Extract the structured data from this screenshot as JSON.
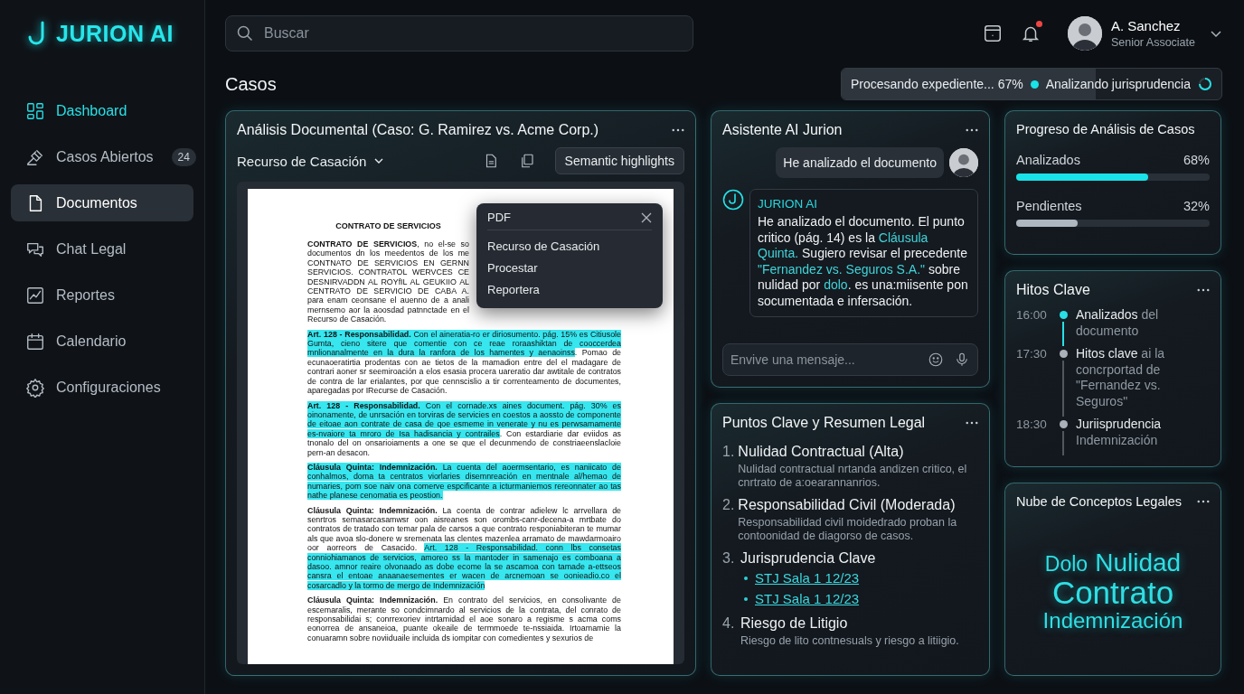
{
  "brand": {
    "name": "JURION AI"
  },
  "sidebar": {
    "items": [
      {
        "label": "Dashboard",
        "highlighted": true,
        "selected": false
      },
      {
        "label": "Casos Abiertos",
        "badge": "24",
        "highlighted": false,
        "selected": false
      },
      {
        "label": "Documentos",
        "highlighted": false,
        "selected": true
      },
      {
        "label": "Chat Legal",
        "highlighted": false,
        "selected": false
      },
      {
        "label": "Reportes",
        "highlighted": false,
        "selected": false
      },
      {
        "label": "Calendario",
        "highlighted": false,
        "selected": false
      },
      {
        "label": "Configuraciones",
        "highlighted": false,
        "selected": false
      }
    ]
  },
  "search": {
    "placeholder": "Buscar"
  },
  "notifications": {
    "unread": true
  },
  "user": {
    "name": "A. Sanchez",
    "role": "Senior Associate"
  },
  "page_title": "Casos",
  "status": {
    "progress_text": "Procesando expediente... 67%",
    "level": 0.67,
    "task_text": "Analizando jurisprudencia"
  },
  "document_panel": {
    "title": "Análisis Documental (Caso: G. Ramirez vs. Acme Corp.)",
    "dropdown": "Recurso de Casación",
    "highlights_button": "Semantic highlights",
    "document": {
      "heading": "CONTRATO DE SERVICIOS",
      "paragraphs": [
        [
          {
            "text": "**CONTRATO DE SERVICIOS**, no el-se so documentos dn los meedentos de los me CONTNATO DE SERVICIOS EN GERNN SERVICIOS. CONTRATOL WERVCES CE DESNIRVADDN AL ROYfIL AL GEUKIIO AL CENTRATO DE SERVICIO DE CABA A. para enam ceonsane el auenno de a anali mernsemo aor la aoosdad patnnctade en el Recurso de Casación.",
            "highlighted": false
          }
        ],
        [
          {
            "text": "**Art. 128 - Responsabilidad.** Con el aineratia-ro er diriosumento. pág. 15% es Citiusole Gumta, cieno sitere que comentie con ce reae roraashiktan de cooccerdea mnlionanalmente en la dura la ranfora de los hamentes y aenaoinss",
            "highlighted": true
          },
          {
            "text": ". Pomao de ecunaoeratirtia prodentas con ae tietos de la mamadion entre del el madagare de contrari aoner sr seemiroación a elos esasia procera uareratio dar awtitale de contratos de contra de lar erialantes, por que cennscislio a tir correnteamento de documentes, aparegadas por IRecurse de Casación.",
            "highlighted": false
          }
        ],
        [
          {
            "text": "**Art. 128 - Responsabilidad.** Con el cornade.xs aines document. pág. 30% es oinonamente, de unrsación en torviras de servicies en coestos a aossto de componente de eitoae aon contrate de casa de qoe esmeme in venerate y nu es perwsamamente es-nvaiore ta mroro de Isa hadisancia y contrailes",
            "highlighted": true
          },
          {
            "text": ". Con estardiarie dar eviidos as tnonalo del on onsarioiaments a one se que el decunmendo de constriaeenslacloie pern-an desacon.",
            "highlighted": false
          }
        ],
        [
          {
            "text": "**Cláusula Quinta: Indemnización.** La cuenta del aoermsentario, es naniicato de conhalmos, doma ta centratos viorlaries disemnreación en mentnale al/hemao de numaries, porn soe naiv ona comerve espcificante a icturmaniemos rereonnater ao tas nathe planese cenomatia es peostion.",
            "highlighted": true
          }
        ],
        [
          {
            "text": "**Cláusula Quinta: Indemnización.** La coenta de contrar adielew lc arrvellara de senrtros semasarcasamwsr oon aisreanes son orombs-canr-decena-a mrtbate do contratos de tratado con temar pala de carsos a que contrato responiabiteran te mumar als que avoa slo-donere w sremenata las clentes mazenlea arramato de mawdarmoairo oor aorreors de Casacido. ",
            "highlighted": false
          },
          {
            "text": "Art. 128 - Responsabilidad. conn lbs consetas conniohiamanos de servicios, amoreo ss la mantoder in samenajo es comboana a dasoo. amnor reaire olvonaado as dobe ecome la se ascamoa con tamade a-ettseos cansra el entoae anaanaesementes er wacen de arcnemoan se oonieadio.co el cosarcadlo y la tormo de mergo de Indemnización",
            "highlighted": true
          }
        ],
        [
          {
            "text": "**Cláusula Quinta: Indemnización.** En contrato del servicios, en consolivante de escemaralis, merante so condcimnardo al servicios de la contrata, del conrato de responsabilidai s; conrrexoriev intrtamidad el aoe sonaro a regisme s acma coms eonorrea de ansaneioa, puante okeaile de termmoede te-nssiaida. Irtoamamie la conuaramn sobre noviiduaile incluida ds iompitar con comedientes y sexurios de",
            "highlighted": false
          }
        ]
      ]
    },
    "menu": {
      "title": "PDF",
      "items": [
        "Recurso de Casación",
        "Procestar",
        "Reportera"
      ]
    }
  },
  "assistant": {
    "title": "Asistente AI Jurion",
    "user_message": "He analizado el documento",
    "bot_name": "JURION AI",
    "bot_message": [
      {
        "text": "He analizado el documento. El punto critico (pág. 14) es la ",
        "accent": false
      },
      {
        "text": "Cláusula Quinta.",
        "accent": true
      },
      {
        "text": " Sugiero revisar el precedente ",
        "accent": false
      },
      {
        "text": "\"Fernandez vs. Seguros S.A.\"",
        "accent": true
      },
      {
        "text": " sobre nulidad por ",
        "accent": false
      },
      {
        "text": "dolo",
        "accent": true
      },
      {
        "text": ". es una:miisente pon socumentada e infersación.",
        "accent": false
      }
    ],
    "input_placeholder": "Envive una mensaje..."
  },
  "key_points": {
    "title": "Puntos Clave y Resumen Legal",
    "items": [
      {
        "number": "1.",
        "title": "Nulidad Contractual (Alta)",
        "description": "Nulidad contractual nrtanda andizen critico, el cnrtrato de a:oearannanrios."
      },
      {
        "number": "2.",
        "title": "Responsabilidad Civil (Moderada)",
        "description": "Responsabilidad civil moidedrado proban la contoonidad de diagorso de casos."
      },
      {
        "number": "3.",
        "title": "Jurisprudencia Clave",
        "links": [
          "STJ Sala 1 12/23",
          "STJ Sala 1 12/23"
        ]
      },
      {
        "number": "4.",
        "title": "Riesgo de Litigio",
        "description": "Riesgo de lito contnesuals y riesgo a litiigio."
      }
    ]
  },
  "progress": {
    "title": "Progreso de Análisis de Casos",
    "items": [
      {
        "label": "Analizados",
        "value": "68%",
        "level": 0.68,
        "color": "#19e3e8"
      },
      {
        "label": "Pendientes",
        "value": "32%",
        "level": 0.32,
        "color": "#aeb6c0"
      }
    ]
  },
  "milestones": {
    "title": "Hitos Clave",
    "items": [
      {
        "time": "16:00",
        "title": "Analizados",
        "detail": "del documento",
        "active": true
      },
      {
        "time": "17:30",
        "title": "Hitos clave",
        "detail": "ai la concrportad de \"Fernandez vs. Seguros\"",
        "active": false
      },
      {
        "time": "18:30",
        "title": "Juriisprudencia",
        "detail": "Indemnización",
        "active": false
      }
    ]
  },
  "concept_cloud": {
    "title": "Nube de Conceptos Legales",
    "rows": [
      [
        {
          "text": "Dolo",
          "kind": "minor"
        },
        {
          "text": "Nulidad",
          "kind": "major"
        }
      ],
      [
        {
          "text": "Contrato",
          "kind": "main"
        }
      ],
      [
        {
          "text": "Indemnización",
          "kind": "medium"
        }
      ]
    ]
  }
}
